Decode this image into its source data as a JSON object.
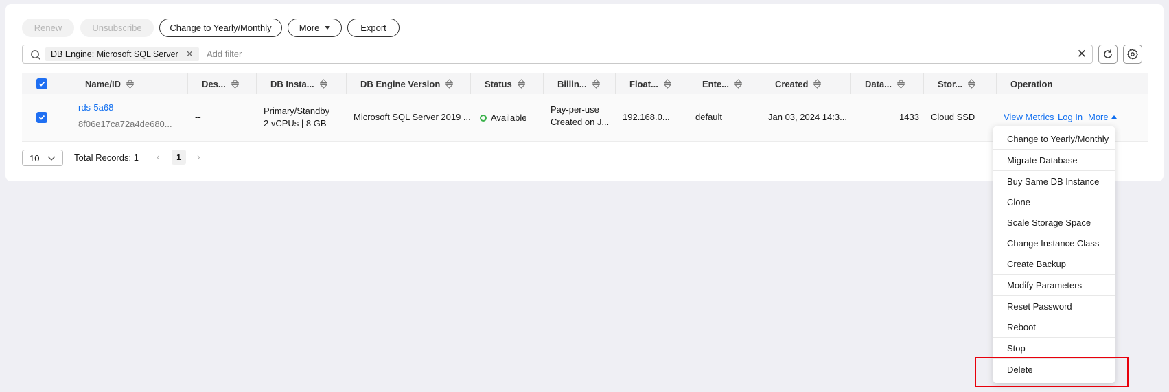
{
  "toolbar": {
    "renew": "Renew",
    "unsubscribe": "Unsubscribe",
    "change_billing": "Change to Yearly/Monthly",
    "more": "More",
    "export": "Export"
  },
  "search": {
    "tag": "DB Engine: Microsoft SQL Server",
    "tag_close": "✕",
    "placeholder": "Add filter",
    "clear": "✕"
  },
  "table": {
    "headers": [
      "Name/ID",
      "Des...",
      "DB Insta...",
      "DB Engine Version",
      "Status",
      "Billin...",
      "Float...",
      "Ente...",
      "Created",
      "Data...",
      "Stor...",
      "Operation"
    ],
    "row": {
      "name": "rds-5a68",
      "id": "8f06e17ca72a4de680...",
      "description": "--",
      "instance_type": "Primary/Standby",
      "instance_spec": "2 vCPUs | 8 GB",
      "engine_version": "Microsoft SQL Server 2019 ...",
      "status": "Available",
      "billing_mode": "Pay-per-use",
      "billing_created": "Created on J...",
      "floating_ip": "192.168.0...",
      "enterprise_project": "default",
      "created": "Jan 03, 2024 14:3...",
      "database_port": "1433",
      "storage": "Cloud SSD",
      "op_view_metrics": "View Metrics",
      "op_login": "Log In",
      "op_more": "More"
    }
  },
  "pagination": {
    "page_size": "10",
    "total": "Total Records: 1",
    "prev": "‹",
    "current": "1",
    "next": "›"
  },
  "more_menu": {
    "items": [
      "Change to Yearly/Monthly",
      "Migrate Database",
      "Buy Same DB Instance",
      "Clone",
      "Scale Storage Space",
      "Change Instance Class",
      "Create Backup",
      "Modify Parameters",
      "Reset Password",
      "Reboot",
      "Stop",
      "Delete"
    ]
  },
  "colors": {
    "primary": "#1f6ff2",
    "link": "#0f6ef0",
    "status_ok": "#3ab14b",
    "highlight": "#e8000b"
  }
}
